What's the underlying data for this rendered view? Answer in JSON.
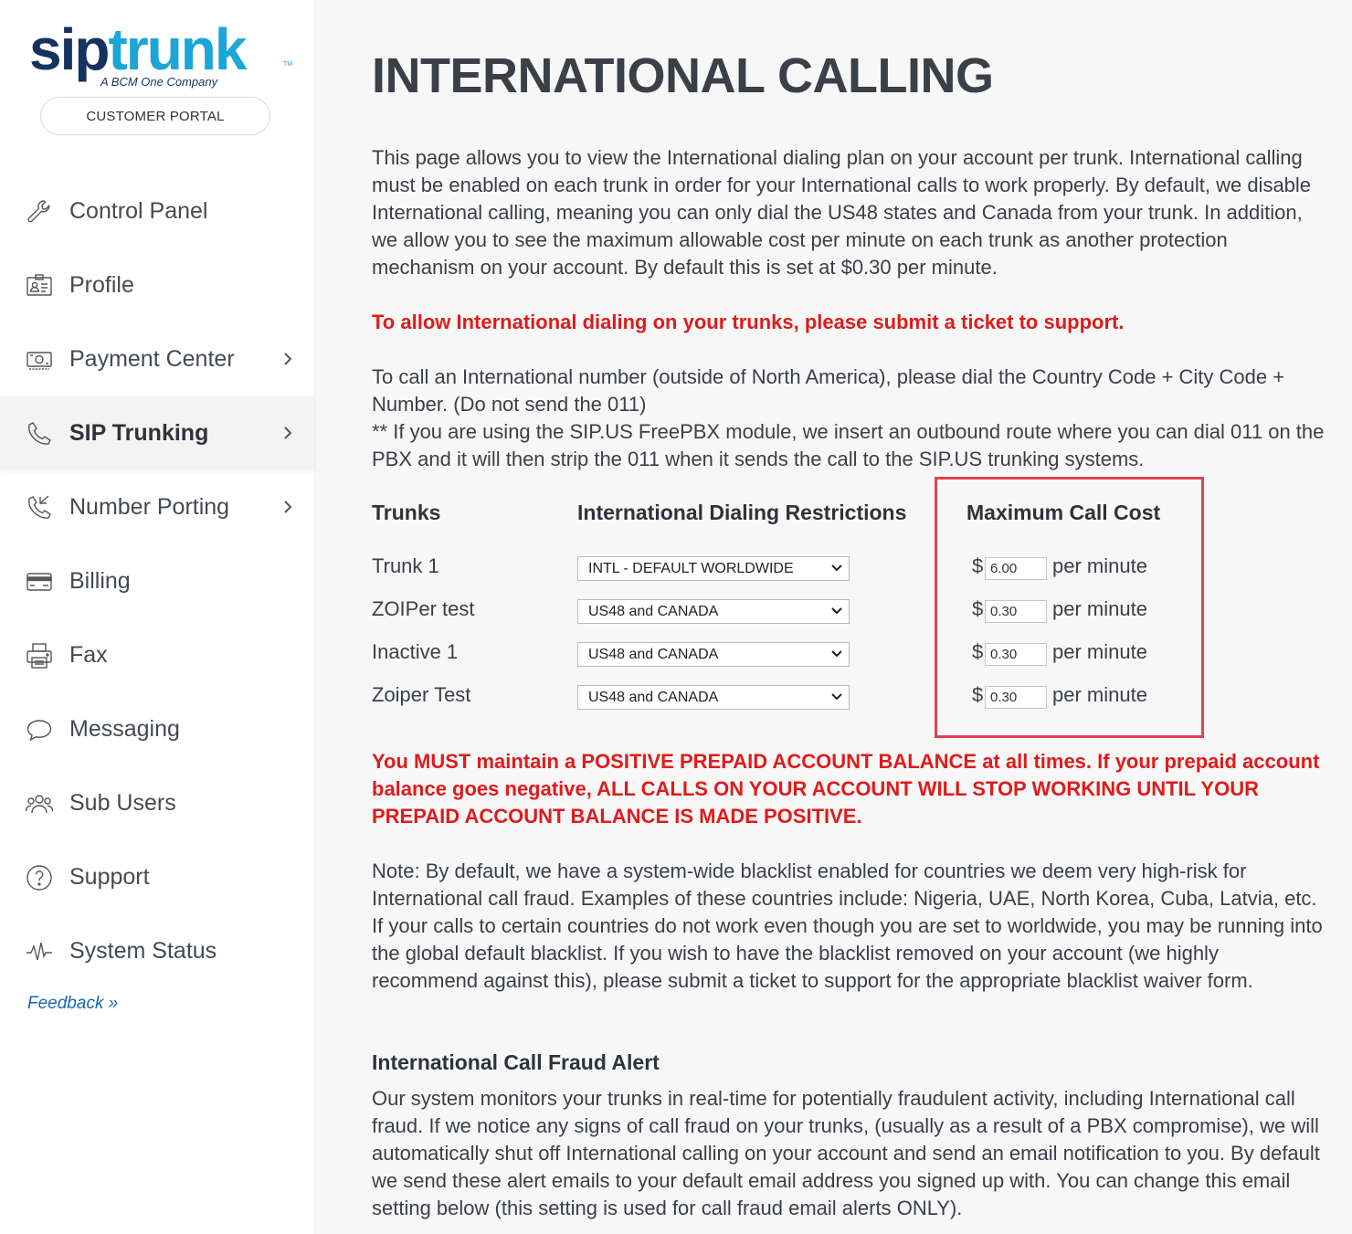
{
  "brand": {
    "logo_sip": "sip",
    "logo_trunk": "trunk",
    "logo_tm": "TM",
    "tagline": "A BCM One Company",
    "portal_button": "CUSTOMER PORTAL",
    "colors": {
      "navy": "#15335e",
      "cyan": "#1ba5d8"
    }
  },
  "sidebar": {
    "items": [
      {
        "label": "Control Panel",
        "icon": "wrench-icon",
        "has_chevron": false,
        "active": false
      },
      {
        "label": "Profile",
        "icon": "id-card-icon",
        "has_chevron": false,
        "active": false
      },
      {
        "label": "Payment Center",
        "icon": "cash-icon",
        "has_chevron": true,
        "active": false
      },
      {
        "label": "SIP Trunking",
        "icon": "phone-icon",
        "has_chevron": true,
        "active": true
      },
      {
        "label": "Number Porting",
        "icon": "phone-forward-icon",
        "has_chevron": true,
        "active": false
      },
      {
        "label": "Billing",
        "icon": "credit-card-icon",
        "has_chevron": false,
        "active": false
      },
      {
        "label": "Fax",
        "icon": "printer-icon",
        "has_chevron": false,
        "active": false
      },
      {
        "label": "Messaging",
        "icon": "chat-bubble-icon",
        "has_chevron": false,
        "active": false
      },
      {
        "label": "Sub Users",
        "icon": "users-icon",
        "has_chevron": false,
        "active": false
      },
      {
        "label": "Support",
        "icon": "question-icon",
        "has_chevron": false,
        "active": false
      },
      {
        "label": "System Status",
        "icon": "pulse-icon",
        "has_chevron": false,
        "active": false
      }
    ],
    "feedback": "Feedback »"
  },
  "main": {
    "title": "INTERNATIONAL CALLING",
    "intro": "This page allows you to view the International dialing plan on your account per trunk. International calling must be enabled on each trunk in order for your International calls to work properly. By default, we disable International calling, meaning you can only dial the US48 states and Canada from your trunk. In addition, we allow you to see the maximum allowable cost per minute on each trunk as another protection mechanism on your account. By default this is set at $0.30 per minute.",
    "ticket_notice": "To allow International dialing on your trunks, please submit a ticket to support.",
    "dial_instructions_1": "To call an International number (outside of North America), please dial the Country Code + City Code + Number. (Do not send the 011)",
    "dial_instructions_2": "** If you are using the SIP.US FreePBX module, we insert an outbound route where you can dial 011 on the PBX and it will then strip the 011 when it sends the call to the SIP.US trunking systems.",
    "table": {
      "col_trunks": "Trunks",
      "col_restrictions": "International Dialing Restrictions",
      "col_cost": "Maximum Call Cost",
      "currency": "$",
      "unit": "per minute",
      "rows": [
        {
          "name": "Trunk 1",
          "restriction": "INTL - DEFAULT WORLDWIDE",
          "cost": "6.00"
        },
        {
          "name": "ZOIPer test",
          "restriction": "US48 and CANADA",
          "cost": "0.30"
        },
        {
          "name": "Inactive 1",
          "restriction": "US48 and CANADA",
          "cost": "0.30"
        },
        {
          "name": "Zoiper Test",
          "restriction": "US48 and CANADA",
          "cost": "0.30"
        }
      ]
    },
    "balance_warning": "You MUST maintain a POSITIVE PREPAID ACCOUNT BALANCE at all times. If your prepaid account balance goes negative, ALL CALLS ON YOUR ACCOUNT WILL STOP WORKING UNTIL YOUR PREPAID ACCOUNT BALANCE IS MADE POSITIVE.",
    "blacklist_note": "Note: By default, we have a system-wide blacklist enabled for countries we deem very high-risk for International call fraud. Examples of these countries include: Nigeria, UAE, North Korea, Cuba, Latvia, etc. If your calls to certain countries do not work even though you are set to worldwide, you may be running into the global default blacklist. If you wish to have the blacklist removed on your account (we highly recommend against this), please submit a ticket to support for the appropriate blacklist waiver form.",
    "fraud_heading": "International Call Fraud Alert",
    "fraud_text": "Our system monitors your trunks in real-time for potentially fraudulent activity, including International call fraud. If we notice any signs of call fraud on your trunks, (usually as a result of a PBX compromise), we will automatically shut off International calling on your account and send an email notification to you. By default we send these alert emails to your default email address you signed up with. You can change this email setting below (this setting is used for call fraud email alerts ONLY)."
  }
}
